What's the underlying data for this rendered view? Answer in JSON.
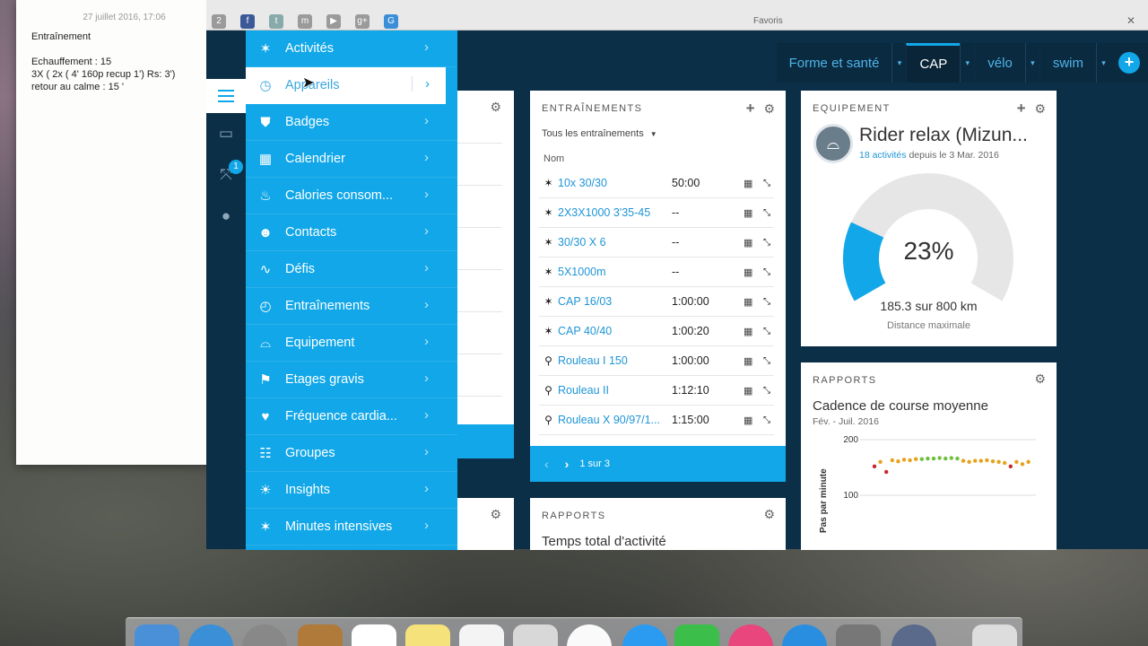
{
  "notes": {
    "date": "27 juillet 2016, 17:06",
    "lines": [
      "Entraînement",
      "",
      "Echauffement : 15",
      "3X ( 2x ( 4' 160p recup 1') Rs: 3')",
      "retour au calme : 15 '"
    ]
  },
  "browser": {
    "favorites_label": "Favoris",
    "bookmark_icons": [
      "2",
      "f",
      "t",
      "m",
      "▶",
      "g+",
      "G"
    ]
  },
  "topnav": {
    "tabs": [
      {
        "label": "Forme et santé",
        "active": false
      },
      {
        "label": "CAP",
        "active": true
      },
      {
        "label": "vélo",
        "active": false
      },
      {
        "label": "swim",
        "active": false
      }
    ],
    "add_symbol": "+"
  },
  "rail": {
    "items": [
      {
        "name": "menu-icon"
      },
      {
        "name": "inbox-icon",
        "glyph": "▭"
      },
      {
        "name": "connections-icon",
        "glyph": "⤧",
        "badge": "1"
      },
      {
        "name": "user-icon",
        "glyph": "●"
      }
    ]
  },
  "menu": {
    "items": [
      {
        "label": "Activités",
        "icon": "runner-icon",
        "glyph": "✶"
      },
      {
        "label": "Appareils",
        "icon": "watch-icon",
        "glyph": "◷",
        "hover": true
      },
      {
        "label": "Badges",
        "icon": "shield-icon",
        "glyph": "⛊"
      },
      {
        "label": "Calendrier",
        "icon": "calendar-icon",
        "glyph": "▦"
      },
      {
        "label": "Calories consom...",
        "icon": "flame-icon",
        "glyph": "♨"
      },
      {
        "label": "Contacts",
        "icon": "people-icon",
        "glyph": "☻"
      },
      {
        "label": "Défis",
        "icon": "wave-icon",
        "glyph": "∿"
      },
      {
        "label": "Entraînements",
        "icon": "stopwatch-icon",
        "glyph": "◴"
      },
      {
        "label": "Equipement",
        "icon": "shoe-icon",
        "glyph": "⌓"
      },
      {
        "label": "Etages gravis",
        "icon": "stairs-icon",
        "glyph": "⚑"
      },
      {
        "label": "Fréquence cardia...",
        "icon": "heart-icon",
        "glyph": "♥"
      },
      {
        "label": "Groupes",
        "icon": "group-icon",
        "glyph": "☷"
      },
      {
        "label": "Insights",
        "icon": "lightbulb-icon",
        "glyph": "☀"
      },
      {
        "label": "Minutes intensives",
        "icon": "intensity-icon",
        "glyph": "✶"
      }
    ]
  },
  "trainings": {
    "title": "ENTRAÎNEMENTS",
    "filter": "Tous les entraînements",
    "col_name": "Nom",
    "rows": [
      {
        "type": "run",
        "name": "10x 30/30",
        "duration": "50:00"
      },
      {
        "type": "run",
        "name": "2X3X1000 3'35-45",
        "duration": "--"
      },
      {
        "type": "run",
        "name": "30/30 X 6",
        "duration": "--"
      },
      {
        "type": "run",
        "name": "5X1000m",
        "duration": "--"
      },
      {
        "type": "run",
        "name": "CAP 16/03",
        "duration": "1:00:00"
      },
      {
        "type": "run",
        "name": "CAP 40/40",
        "duration": "1:00:20"
      },
      {
        "type": "bike",
        "name": "Rouleau I 150",
        "duration": "1:00:00"
      },
      {
        "type": "bike",
        "name": "Rouleau II",
        "duration": "1:12:10"
      },
      {
        "type": "bike",
        "name": "Rouleau X 90/97/1...",
        "duration": "1:15:00"
      }
    ],
    "pager": "1 sur 3"
  },
  "equipment": {
    "title": "EQUIPEMENT",
    "name": "Rider relax (Mizun...",
    "activities_link": "18 activités",
    "since": "depuis le 3 Mar. 2016",
    "percent": 23,
    "percent_label": "23%",
    "distance_text": "185.3 sur 800 km",
    "distance_caption": "Distance maximale",
    "colors": {
      "fill": "#11a7e8",
      "track": "#e6e6e6"
    }
  },
  "reports": {
    "title": "RAPPORTS",
    "subtitle": "Cadence de course moyenne",
    "range": "Fév. - Juil. 2016",
    "ylabel": "Pas par minute",
    "yticks": [
      "200",
      "100"
    ]
  },
  "reports2": {
    "title": "RAPPORTS",
    "subtitle": "Temps total d'activité"
  },
  "chart_data": {
    "type": "scatter",
    "title": "Cadence de course moyenne",
    "ylabel": "Pas par minute",
    "ylim": [
      0,
      200
    ],
    "yticks": [
      100,
      200
    ],
    "grid": true,
    "values": [
      152,
      160,
      142,
      163,
      161,
      164,
      163,
      165,
      165,
      166,
      166,
      167,
      166,
      167,
      166,
      162,
      160,
      162,
      162,
      163,
      161,
      160,
      158,
      152,
      160,
      156,
      160
    ],
    "point_colors": [
      "#c8272a",
      "#e6a21b",
      "#c8272a",
      "#e6a21b",
      "#e6a21b",
      "#e6a21b",
      "#e6a21b",
      "#e6a21b",
      "#6fbf3e",
      "#6fbf3e",
      "#6fbf3e",
      "#6fbf3e",
      "#6fbf3e",
      "#6fbf3e",
      "#6fbf3e",
      "#e6a21b",
      "#e6a21b",
      "#e6a21b",
      "#e6a21b",
      "#e6a21b",
      "#e6a21b",
      "#e6a21b",
      "#e6a21b",
      "#c8272a",
      "#e6a21b",
      "#e6a21b",
      "#e6a21b"
    ]
  }
}
